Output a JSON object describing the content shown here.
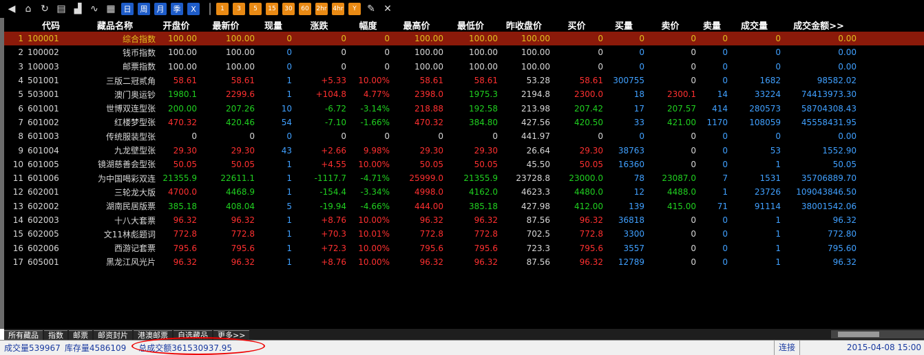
{
  "toolbar": {
    "buttons": [
      "日",
      "周",
      "月",
      "季",
      "X"
    ],
    "periods": [
      "1",
      "3",
      "5",
      "15",
      "30",
      "60",
      "2hr",
      "4hr",
      "Y"
    ]
  },
  "columns": [
    "代码",
    "藏品名称",
    "开盘价",
    "最新价",
    "现量",
    "涨跌",
    "幅度",
    "最高价",
    "最低价",
    "昨收盘价",
    "买价",
    "买量",
    "卖价",
    "卖量",
    "成交量",
    "成交金额>>"
  ],
  "rows": [
    {
      "idx": "1",
      "code": "100001",
      "name": "综合指数",
      "open": "100.00",
      "last": "100.00",
      "vol": "0",
      "chg": "0",
      "pct": "0",
      "hi": "100.00",
      "lo": "100.00",
      "prev": "100.00",
      "bid": "0",
      "bidq": "0",
      "ask": "0",
      "askq": "0",
      "tvol": "0",
      "amt": "0.00",
      "selected": true
    },
    {
      "idx": "2",
      "code": "100002",
      "name": "钱币指数",
      "open": "100.00",
      "last": "100.00",
      "vol": "0",
      "chg": "0",
      "pct": "0",
      "hi": "100.00",
      "lo": "100.00",
      "prev": "100.00",
      "bid": "0",
      "bidq": "0",
      "ask": "0",
      "askq": "0",
      "tvol": "0",
      "amt": "0.00"
    },
    {
      "idx": "3",
      "code": "100003",
      "name": "邮票指数",
      "open": "100.00",
      "last": "100.00",
      "vol": "0",
      "chg": "0",
      "pct": "0",
      "hi": "100.00",
      "lo": "100.00",
      "prev": "100.00",
      "bid": "0",
      "bidq": "0",
      "ask": "0",
      "askq": "0",
      "tvol": "0",
      "amt": "0.00"
    },
    {
      "idx": "4",
      "code": "501001",
      "name": "三版二冠贰角",
      "open": "58.61",
      "last": "58.61",
      "vol": "1",
      "chg": "+5.33",
      "pct": "10.00%",
      "hi": "58.61",
      "lo": "58.61",
      "prev": "53.28",
      "bid": "58.61",
      "bidq": "300755",
      "ask": "0",
      "askq": "0",
      "tvol": "1682",
      "amt": "98582.02"
    },
    {
      "idx": "5",
      "code": "503001",
      "name": "澳门奥运钞",
      "open": "1980.1",
      "last": "2299.6",
      "vol": "1",
      "chg": "+104.8",
      "pct": "4.77%",
      "hi": "2398.0",
      "lo": "1975.3",
      "prev": "2194.8",
      "bid": "2300.0",
      "bidq": "18",
      "ask": "2300.1",
      "askq": "14",
      "tvol": "33224",
      "amt": "74413973.30"
    },
    {
      "idx": "6",
      "code": "601001",
      "name": "世博双连型张",
      "open": "200.00",
      "last": "207.26",
      "vol": "10",
      "chg": "-6.72",
      "pct": "-3.14%",
      "hi": "218.88",
      "lo": "192.58",
      "prev": "213.98",
      "bid": "207.42",
      "bidq": "17",
      "ask": "207.57",
      "askq": "414",
      "tvol": "280573",
      "amt": "58704308.43"
    },
    {
      "idx": "7",
      "code": "601002",
      "name": "红楼梦型张",
      "open": "470.32",
      "last": "420.46",
      "vol": "54",
      "chg": "-7.10",
      "pct": "-1.66%",
      "hi": "470.32",
      "lo": "384.80",
      "prev": "427.56",
      "bid": "420.50",
      "bidq": "33",
      "ask": "421.00",
      "askq": "1170",
      "tvol": "108059",
      "amt": "45558431.95"
    },
    {
      "idx": "8",
      "code": "601003",
      "name": "传统服装型张",
      "open": "0",
      "last": "0",
      "vol": "0",
      "chg": "0",
      "pct": "0",
      "hi": "0",
      "lo": "0",
      "prev": "441.97",
      "bid": "0",
      "bidq": "0",
      "ask": "0",
      "askq": "0",
      "tvol": "0",
      "amt": "0.00"
    },
    {
      "idx": "9",
      "code": "601004",
      "name": "九龙壁型张",
      "open": "29.30",
      "last": "29.30",
      "vol": "43",
      "chg": "+2.66",
      "pct": "9.98%",
      "hi": "29.30",
      "lo": "29.30",
      "prev": "26.64",
      "bid": "29.30",
      "bidq": "38763",
      "ask": "0",
      "askq": "0",
      "tvol": "53",
      "amt": "1552.90"
    },
    {
      "idx": "10",
      "code": "601005",
      "name": "镜湖慈善会型张",
      "open": "50.05",
      "last": "50.05",
      "vol": "1",
      "chg": "+4.55",
      "pct": "10.00%",
      "hi": "50.05",
      "lo": "50.05",
      "prev": "45.50",
      "bid": "50.05",
      "bidq": "16360",
      "ask": "0",
      "askq": "0",
      "tvol": "1",
      "amt": "50.05"
    },
    {
      "idx": "11",
      "code": "601006",
      "name": "为中国喝彩双连",
      "open": "21355.9",
      "last": "22611.1",
      "vol": "1",
      "chg": "-1117.7",
      "pct": "-4.71%",
      "hi": "25999.0",
      "lo": "21355.9",
      "prev": "23728.8",
      "bid": "23000.0",
      "bidq": "78",
      "ask": "23087.0",
      "askq": "7",
      "tvol": "1531",
      "amt": "35706889.70"
    },
    {
      "idx": "12",
      "code": "602001",
      "name": "三轮龙大版",
      "open": "4700.0",
      "last": "4468.9",
      "vol": "1",
      "chg": "-154.4",
      "pct": "-3.34%",
      "hi": "4998.0",
      "lo": "4162.0",
      "prev": "4623.3",
      "bid": "4480.0",
      "bidq": "12",
      "ask": "4488.0",
      "askq": "1",
      "tvol": "23726",
      "amt": "109043846.50"
    },
    {
      "idx": "13",
      "code": "602002",
      "name": "湖南民居版票",
      "open": "385.18",
      "last": "408.04",
      "vol": "5",
      "chg": "-19.94",
      "pct": "-4.66%",
      "hi": "444.00",
      "lo": "385.18",
      "prev": "427.98",
      "bid": "412.00",
      "bidq": "139",
      "ask": "415.00",
      "askq": "71",
      "tvol": "91114",
      "amt": "38001542.06"
    },
    {
      "idx": "14",
      "code": "602003",
      "name": "十八大套票",
      "open": "96.32",
      "last": "96.32",
      "vol": "1",
      "chg": "+8.76",
      "pct": "10.00%",
      "hi": "96.32",
      "lo": "96.32",
      "prev": "87.56",
      "bid": "96.32",
      "bidq": "36818",
      "ask": "0",
      "askq": "0",
      "tvol": "1",
      "amt": "96.32"
    },
    {
      "idx": "15",
      "code": "602005",
      "name": "文11林彪题词",
      "open": "772.8",
      "last": "772.8",
      "vol": "1",
      "chg": "+70.3",
      "pct": "10.01%",
      "hi": "772.8",
      "lo": "772.8",
      "prev": "702.5",
      "bid": "772.8",
      "bidq": "3300",
      "ask": "0",
      "askq": "0",
      "tvol": "1",
      "amt": "772.80"
    },
    {
      "idx": "16",
      "code": "602006",
      "name": "西游记套票",
      "open": "795.6",
      "last": "795.6",
      "vol": "1",
      "chg": "+72.3",
      "pct": "10.00%",
      "hi": "795.6",
      "lo": "795.6",
      "prev": "723.3",
      "bid": "795.6",
      "bidq": "3557",
      "ask": "0",
      "askq": "0",
      "tvol": "1",
      "amt": "795.60"
    },
    {
      "idx": "17",
      "code": "605001",
      "name": "黑龙江风光片",
      "open": "96.32",
      "last": "96.32",
      "vol": "1",
      "chg": "+8.76",
      "pct": "10.00%",
      "hi": "96.32",
      "lo": "96.32",
      "prev": "87.56",
      "bid": "96.32",
      "bidq": "12789",
      "ask": "0",
      "askq": "0",
      "tvol": "1",
      "amt": "96.32"
    }
  ],
  "tabs": [
    "所有藏品",
    "指数",
    "邮票",
    "邮资封片",
    "港澳邮票",
    "自选藏品",
    "更多>>"
  ],
  "status": {
    "volume": "成交量539967",
    "stock": "库存量4586109",
    "amount": "总成交额361530937.95",
    "connection": "连接",
    "datetime": "2015-04-08 15:00"
  },
  "colors": {
    "up": "#ff3030",
    "down": "#20d020",
    "neutral": "#d8d8d8",
    "qty": "#40a0ff",
    "selected_bg": "#8b1a0a"
  }
}
